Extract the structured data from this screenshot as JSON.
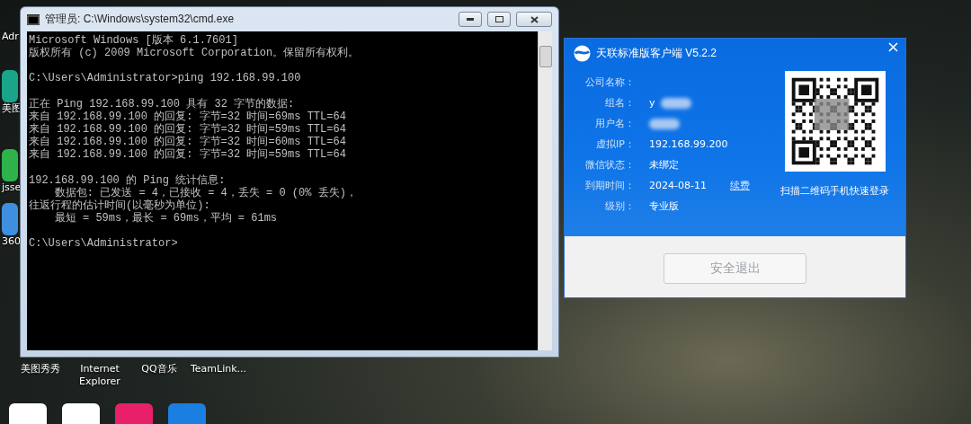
{
  "desktop": {
    "left_icons": [
      {
        "label": "Adr"
      },
      {
        "label": "美图"
      },
      {
        "label": "jsse"
      },
      {
        "label": "360"
      }
    ],
    "bottom_icons": [
      {
        "label": "美图秀秀"
      },
      {
        "label": "Internet Explorer"
      },
      {
        "label": "QQ音乐"
      },
      {
        "label": "TeamLink..."
      }
    ]
  },
  "console_window": {
    "title": "管理员: C:\\Windows\\system32\\cmd.exe",
    "blocks": [
      [
        "Microsoft Windows [版本 6.1.7601]",
        "版权所有 (c) 2009 Microsoft Corporation。保留所有权利。"
      ],
      [
        "C:\\Users\\Administrator>ping 192.168.99.100"
      ],
      [
        "正在 Ping 192.168.99.100 具有 32 字节的数据:",
        "来自 192.168.99.100 的回复: 字节=32 时间=69ms TTL=64",
        "来自 192.168.99.100 的回复: 字节=32 时间=59ms TTL=64",
        "来自 192.168.99.100 的回复: 字节=32 时间=60ms TTL=64",
        "来自 192.168.99.100 的回复: 字节=32 时间=59ms TTL=64"
      ],
      [
        "192.168.99.100 的 Ping 统计信息:",
        "    数据包: 已发送 = 4，已接收 = 4，丢失 = 0 (0% 丢失)，",
        "往返行程的估计时间(以毫秒为单位):",
        "    最短 = 59ms，最长 = 69ms，平均 = 61ms"
      ],
      [
        "C:\\Users\\Administrator>"
      ]
    ]
  },
  "client_window": {
    "title": "天联标准版客户端 V5.2.2",
    "fields": [
      {
        "label": "公司名称：",
        "blurred": false
      },
      {
        "label": "组名：",
        "value": "y",
        "blurred": true
      },
      {
        "label": "用户名：",
        "blurred": true
      },
      {
        "label": "虚拟IP：",
        "value": "192.168.99.200",
        "blurred": false
      },
      {
        "label": "微信状态：",
        "value": "未绑定",
        "blurred": false
      },
      {
        "label": "到期时间：",
        "value": "2024-08-11",
        "link": "续费",
        "blurred": false
      },
      {
        "label": "级别：",
        "value": "专业版",
        "blurred": false
      }
    ],
    "qr_caption": "扫描二维码手机快速登录",
    "button": "安全退出"
  }
}
